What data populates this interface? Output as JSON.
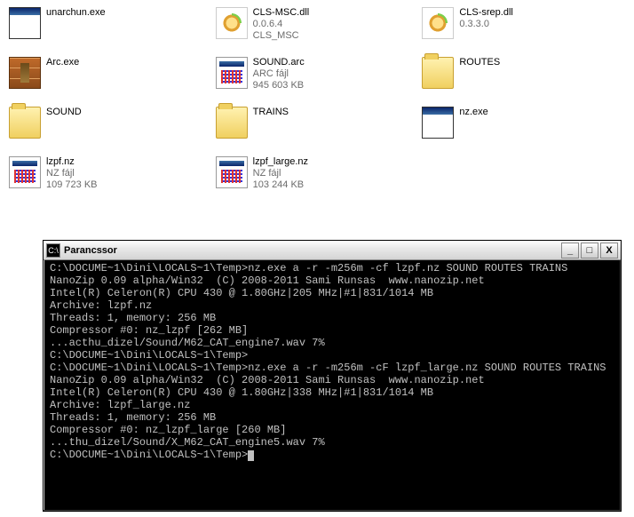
{
  "files": [
    {
      "icon": "exe",
      "name": "unarchun.exe",
      "meta1": "",
      "meta2": ""
    },
    {
      "icon": "dll",
      "name": "CLS-MSC.dll",
      "meta1": "0.0.6.4",
      "meta2": "CLS_MSC"
    },
    {
      "icon": "dll",
      "name": "CLS-srep.dll",
      "meta1": "0.3.3.0",
      "meta2": ""
    },
    {
      "icon": "arc",
      "name": "Arc.exe",
      "meta1": "",
      "meta2": ""
    },
    {
      "icon": "bin",
      "name": "SOUND.arc",
      "meta1": "ARC fájl",
      "meta2": "945 603 KB"
    },
    {
      "icon": "folder",
      "name": "ROUTES",
      "meta1": "",
      "meta2": ""
    },
    {
      "icon": "folder",
      "name": "SOUND",
      "meta1": "",
      "meta2": ""
    },
    {
      "icon": "folder",
      "name": "TRAINS",
      "meta1": "",
      "meta2": ""
    },
    {
      "icon": "exe",
      "name": "nz.exe",
      "meta1": "",
      "meta2": ""
    },
    {
      "icon": "bin",
      "name": "lzpf.nz",
      "meta1": "NZ fájl",
      "meta2": "109 723 KB"
    },
    {
      "icon": "bin",
      "name": "lzpf_large.nz",
      "meta1": "NZ fájl",
      "meta2": "103 244 KB"
    }
  ],
  "terminal": {
    "title": "Parancssor",
    "cmd_icon": "C:\\",
    "buttons": {
      "min": "_",
      "max": "□",
      "close": "X"
    },
    "lines": [
      "C:\\DOCUME~1\\Dini\\LOCALS~1\\Temp>nz.exe a -r -m256m -cf lzpf.nz SOUND ROUTES TRAINS",
      "NanoZip 0.09 alpha/Win32  (C) 2008-2011 Sami Runsas  www.nanozip.net",
      "Intel(R) Celeron(R) CPU 430 @ 1.80GHz|205 MHz|#1|831/1014 MB",
      "Archive: lzpf.nz",
      "Threads: 1, memory: 256 MB",
      "Compressor #0: nz_lzpf [262 MB]",
      "...acthu_dizel/Sound/M62_CAT_engine7.wav 7%",
      "C:\\DOCUME~1\\Dini\\LOCALS~1\\Temp>",
      "C:\\DOCUME~1\\Dini\\LOCALS~1\\Temp>nz.exe a -r -m256m -cF lzpf_large.nz SOUND ROUTES TRAINS",
      "NanoZip 0.09 alpha/Win32  (C) 2008-2011 Sami Runsas  www.nanozip.net",
      "Intel(R) Celeron(R) CPU 430 @ 1.80GHz|338 MHz|#1|831/1014 MB",
      "Archive: lzpf_large.nz",
      "Threads: 1, memory: 256 MB",
      "Compressor #0: nz_lzpf_large [260 MB]",
      "...thu_dizel/Sound/X_M62_CAT_engine5.wav 7%",
      "C:\\DOCUME~1\\Dini\\LOCALS~1\\Temp>"
    ]
  }
}
